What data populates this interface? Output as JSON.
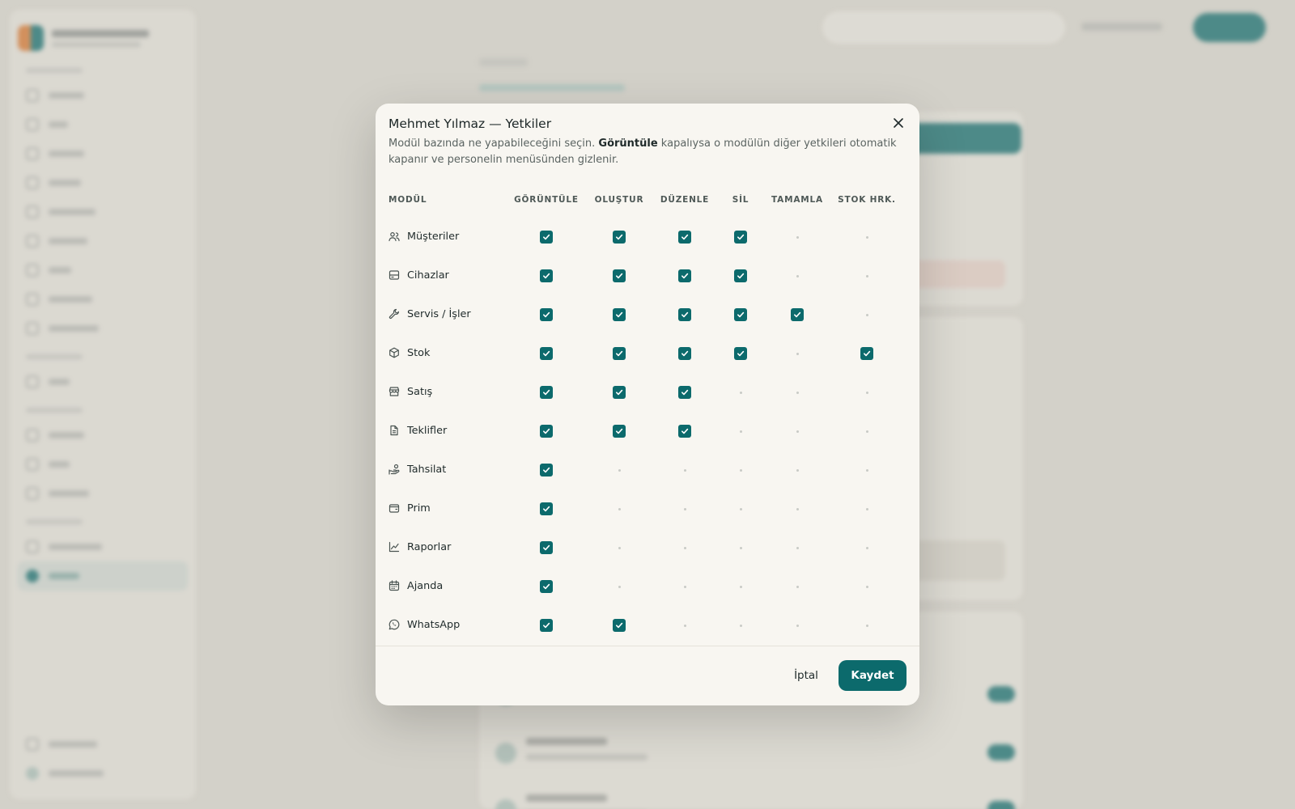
{
  "colors": {
    "accent": "#0c6a6c",
    "modal_bg": "#f8f6f1",
    "page_bg": "#d9d7cf"
  },
  "modal": {
    "title": "Mehmet Yılmaz — Yetkiler",
    "description_pre": "Modül bazında ne yapabileceğini seçin. ",
    "description_bold": "Görüntüle",
    "description_post": " kapalıysa o modülün diğer yetkileri otomatik kapanır ve personelin menüsünden gizlenir.",
    "columns": [
      "MODÜL",
      "GÖRÜNTÜLE",
      "OLUŞTUR",
      "DÜZENLE",
      "SİL",
      "TAMAMLA",
      "STOK HRK."
    ],
    "rows": [
      {
        "name": "Müşteriler",
        "icon": "users-icon",
        "perms": [
          true,
          true,
          true,
          true,
          null,
          null
        ]
      },
      {
        "name": "Cihazlar",
        "icon": "device-icon",
        "perms": [
          true,
          true,
          true,
          true,
          null,
          null
        ]
      },
      {
        "name": "Servis / İşler",
        "icon": "wrench-icon",
        "perms": [
          true,
          true,
          true,
          true,
          true,
          null
        ]
      },
      {
        "name": "Stok",
        "icon": "box-icon",
        "perms": [
          true,
          true,
          true,
          true,
          null,
          true
        ]
      },
      {
        "name": "Satış",
        "icon": "store-icon",
        "perms": [
          true,
          true,
          true,
          null,
          null,
          null
        ]
      },
      {
        "name": "Teklifler",
        "icon": "document-icon",
        "perms": [
          true,
          true,
          true,
          null,
          null,
          null
        ]
      },
      {
        "name": "Tahsilat",
        "icon": "hand-coins-icon",
        "perms": [
          true,
          null,
          null,
          null,
          null,
          null
        ]
      },
      {
        "name": "Prim",
        "icon": "wallet-icon",
        "perms": [
          true,
          null,
          null,
          null,
          null,
          null
        ]
      },
      {
        "name": "Raporlar",
        "icon": "chart-icon",
        "perms": [
          true,
          null,
          null,
          null,
          null,
          null
        ]
      },
      {
        "name": "Ajanda",
        "icon": "calendar-icon",
        "perms": [
          true,
          null,
          null,
          null,
          null,
          null
        ]
      },
      {
        "name": "WhatsApp",
        "icon": "whatsapp-icon",
        "perms": [
          true,
          true,
          null,
          null,
          null,
          null
        ]
      }
    ],
    "cancel_label": "İptal",
    "save_label": "Kaydet"
  }
}
